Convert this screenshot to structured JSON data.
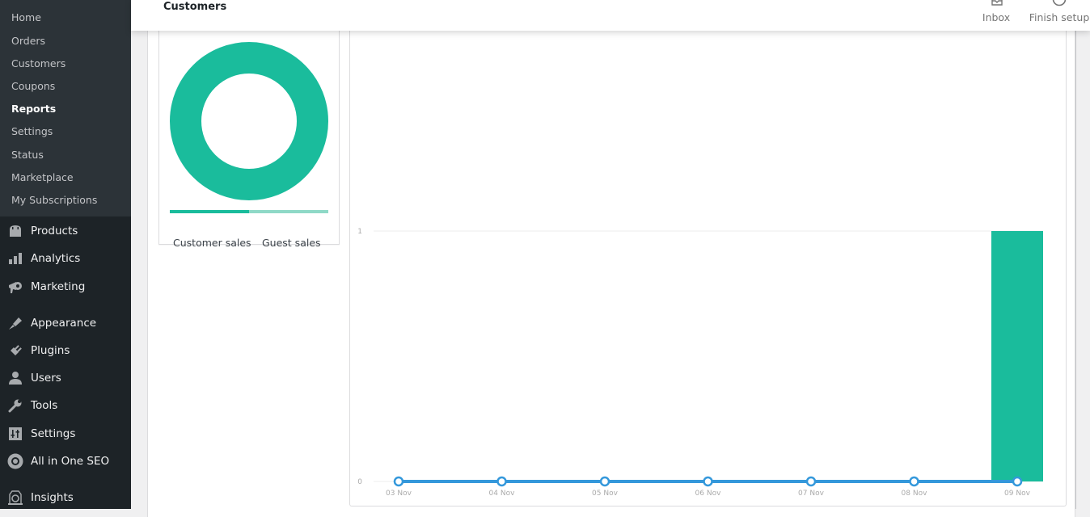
{
  "sidebar": {
    "submenu": [
      {
        "label": "Home",
        "current": false
      },
      {
        "label": "Orders",
        "current": false
      },
      {
        "label": "Customers",
        "current": false
      },
      {
        "label": "Coupons",
        "current": false
      },
      {
        "label": "Reports",
        "current": true
      },
      {
        "label": "Settings",
        "current": false
      },
      {
        "label": "Status",
        "current": false
      },
      {
        "label": "Marketplace",
        "current": false
      },
      {
        "label": "My Subscriptions",
        "current": false
      }
    ],
    "menu": [
      {
        "label": "Products",
        "icon": "products-icon"
      },
      {
        "label": "Analytics",
        "icon": "analytics-icon"
      },
      {
        "label": "Marketing",
        "icon": "megaphone-icon"
      },
      {
        "label": "Appearance",
        "icon": "paintbrush-icon"
      },
      {
        "label": "Plugins",
        "icon": "plugin-icon"
      },
      {
        "label": "Users",
        "icon": "user-icon"
      },
      {
        "label": "Tools",
        "icon": "wrench-icon"
      },
      {
        "label": "Settings",
        "icon": "settings-sliders-icon"
      },
      {
        "label": "All in One SEO",
        "icon": "aioseo-icon"
      },
      {
        "label": "Insights",
        "icon": "insights-icon"
      }
    ]
  },
  "header": {
    "title": "Customers",
    "actions": [
      {
        "label": "Inbox",
        "icon": "inbox-icon"
      },
      {
        "label": "Finish setup",
        "icon": "progress-circle-icon"
      }
    ]
  },
  "colors": {
    "accent": "#1abc9c",
    "accent_light": "#8fd9c7",
    "line": "#3498db",
    "sidebar_bg": "#1d2327",
    "submenu_bg": "#2c3338"
  },
  "chart_data": [
    {
      "type": "pie",
      "title": "",
      "donut": true,
      "legend": [
        "Customer sales",
        "Guest sales"
      ],
      "values": [
        1,
        0
      ],
      "legend_placement": "bottom"
    },
    {
      "type": "bar",
      "categories": [
        "03 Nov",
        "04 Nov",
        "05 Nov",
        "06 Nov",
        "07 Nov",
        "08 Nov",
        "09 Nov"
      ],
      "series": [
        {
          "name": "Customer sales",
          "type": "bar",
          "values": [
            0,
            0,
            0,
            0,
            0,
            0,
            1
          ]
        },
        {
          "name": "Guest sales",
          "type": "line",
          "values": [
            0,
            0,
            0,
            0,
            0,
            0,
            0
          ]
        }
      ],
      "yticks": [
        "0",
        "1"
      ],
      "ylim": [
        0,
        1
      ],
      "grid": true
    }
  ]
}
